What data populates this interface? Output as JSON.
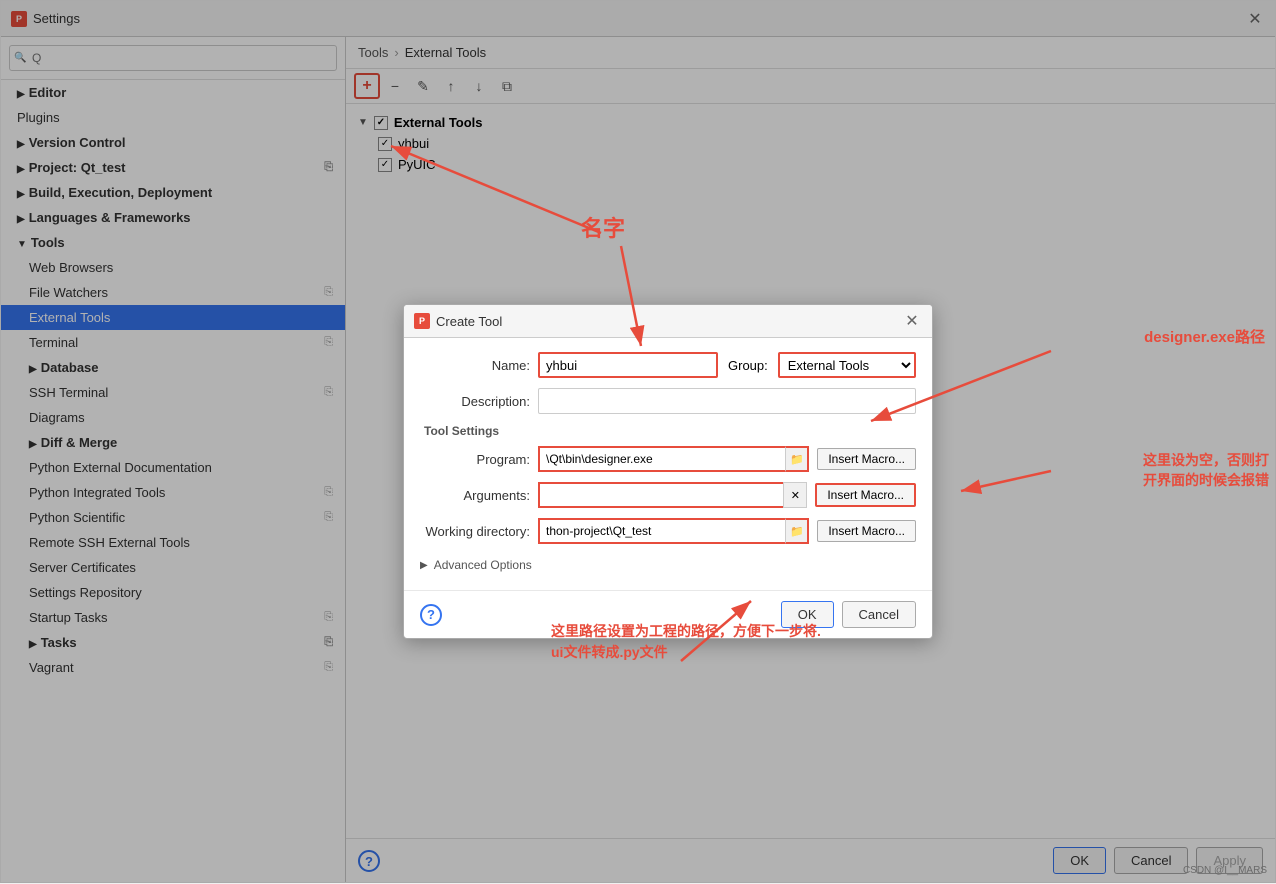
{
  "window": {
    "title": "Settings",
    "close_icon": "✕"
  },
  "breadcrumb": {
    "root": "Tools",
    "separator": "›",
    "current": "External Tools"
  },
  "toolbar": {
    "add": "+",
    "remove": "−",
    "edit": "✎",
    "up": "↑",
    "down": "↓",
    "copy": "⧉"
  },
  "tools_list": {
    "group_name": "External Tools",
    "items": [
      "yhbui",
      "PyUIC"
    ]
  },
  "sidebar": {
    "search_placeholder": "Q",
    "items": [
      {
        "id": "editor",
        "label": "Editor",
        "level": 0,
        "expandable": true
      },
      {
        "id": "plugins",
        "label": "Plugins",
        "level": 0
      },
      {
        "id": "version-control",
        "label": "Version Control",
        "level": 0,
        "expandable": true
      },
      {
        "id": "project-qt",
        "label": "Project: Qt_test",
        "level": 0,
        "expandable": true
      },
      {
        "id": "build-exec",
        "label": "Build, Execution, Deployment",
        "level": 0,
        "expandable": true
      },
      {
        "id": "languages",
        "label": "Languages & Frameworks",
        "level": 0,
        "expandable": true
      },
      {
        "id": "tools",
        "label": "Tools",
        "level": 0,
        "expandable": true,
        "expanded": true
      },
      {
        "id": "web-browsers",
        "label": "Web Browsers",
        "level": 1
      },
      {
        "id": "file-watchers",
        "label": "File Watchers",
        "level": 1,
        "has_icon": true
      },
      {
        "id": "external-tools",
        "label": "External Tools",
        "level": 1,
        "active": true
      },
      {
        "id": "terminal",
        "label": "Terminal",
        "level": 1,
        "has_icon": true
      },
      {
        "id": "database",
        "label": "Database",
        "level": 1,
        "expandable": true
      },
      {
        "id": "ssh-terminal",
        "label": "SSH Terminal",
        "level": 1,
        "has_icon": true
      },
      {
        "id": "diagrams",
        "label": "Diagrams",
        "level": 1
      },
      {
        "id": "diff-merge",
        "label": "Diff & Merge",
        "level": 1,
        "expandable": true
      },
      {
        "id": "python-ext-doc",
        "label": "Python External Documentation",
        "level": 1
      },
      {
        "id": "python-int-tools",
        "label": "Python Integrated Tools",
        "level": 1,
        "has_icon": true
      },
      {
        "id": "python-scientific",
        "label": "Python Scientific",
        "level": 1,
        "has_icon": true
      },
      {
        "id": "remote-ssh",
        "label": "Remote SSH External Tools",
        "level": 1
      },
      {
        "id": "server-certs",
        "label": "Server Certificates",
        "level": 1
      },
      {
        "id": "settings-repo",
        "label": "Settings Repository",
        "level": 1
      },
      {
        "id": "startup-tasks",
        "label": "Startup Tasks",
        "level": 1,
        "has_icon": true
      },
      {
        "id": "tasks",
        "label": "Tasks",
        "level": 1,
        "expandable": true,
        "has_icon": true
      },
      {
        "id": "vagrant",
        "label": "Vagrant",
        "level": 1,
        "has_icon": true
      }
    ]
  },
  "dialog": {
    "title": "Create Tool",
    "close_icon": "✕",
    "name_label": "Name:",
    "name_value": "yhbui",
    "group_label": "Group:",
    "group_value": "External Tools",
    "description_label": "Description:",
    "description_value": "",
    "tool_settings_label": "Tool Settings",
    "program_label": "Program:",
    "program_value": "\\Qt\\bin\\designer.exe",
    "arguments_label": "Arguments:",
    "arguments_value": "",
    "working_dir_label": "Working directory:",
    "working_dir_value": "thon-project\\Qt_test",
    "insert_macro": "Insert Macro...",
    "advanced_label": "Advanced Options",
    "ok_label": "OK",
    "cancel_label": "Cancel"
  },
  "annotations": {
    "name_label": "名字",
    "designer_path": "designer.exe路径",
    "empty_note": "这里设为空，否则打\n开界面的时候会报错",
    "path_note": "这里路径设置为工程的路径，方便下一步将.\nui文件转成.py文件"
  },
  "bottom_bar": {
    "ok_label": "OK",
    "cancel_label": "Cancel",
    "apply_label": "Apply"
  },
  "watermark": "CSDN @I__MARS"
}
